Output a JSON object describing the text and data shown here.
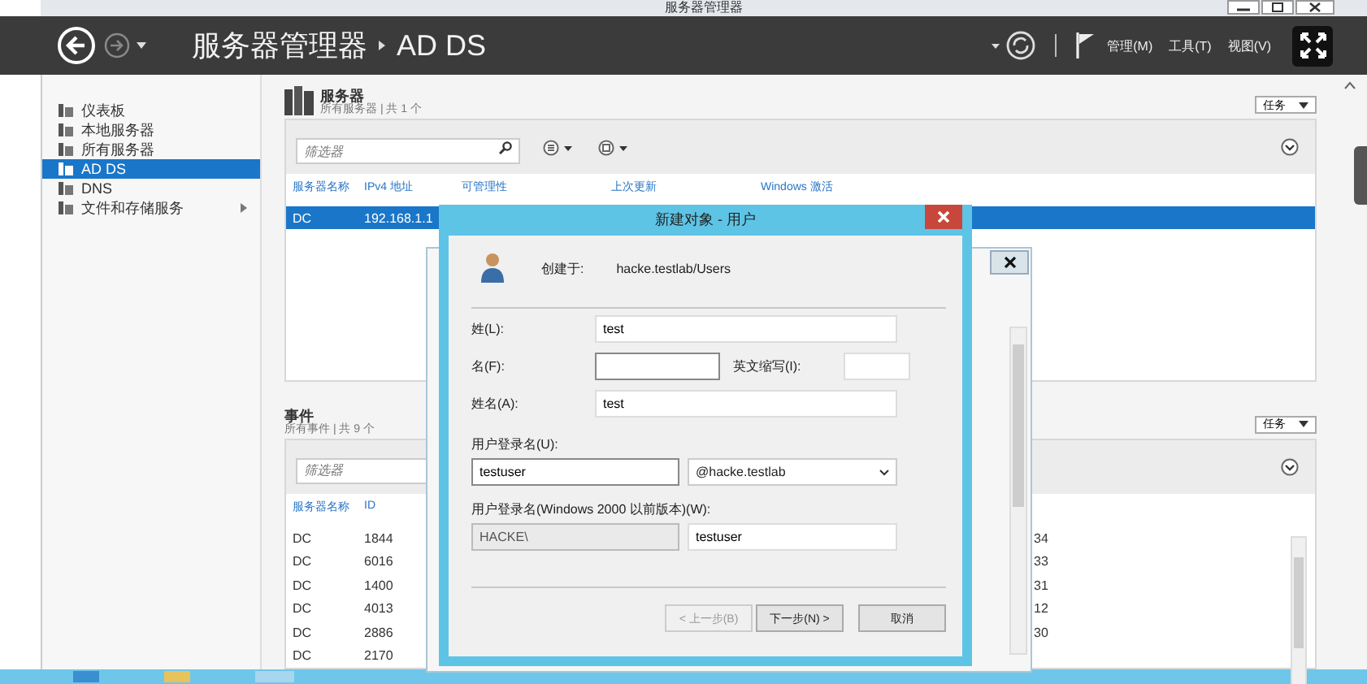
{
  "window": {
    "title": "服务器管理器"
  },
  "header": {
    "breadcrumb": [
      "服务器管理器",
      "AD DS"
    ],
    "menus": [
      "管理(M)",
      "工具(T)",
      "视图(V)"
    ]
  },
  "sidebar": {
    "items": [
      {
        "label": "仪表板",
        "selected": false,
        "has_submenu": false
      },
      {
        "label": "本地服务器",
        "selected": false,
        "has_submenu": false
      },
      {
        "label": "所有服务器",
        "selected": false,
        "has_submenu": false
      },
      {
        "label": "AD DS",
        "selected": true,
        "has_submenu": false
      },
      {
        "label": "DNS",
        "selected": false,
        "has_submenu": false
      },
      {
        "label": "文件和存储服务",
        "selected": false,
        "has_submenu": true
      }
    ]
  },
  "servers": {
    "title": "服务器",
    "subtitle": "所有服务器 | 共 1 个",
    "tasks_button": "任务",
    "filter": {
      "placeholder": "筛选器"
    },
    "columns": [
      "服务器名称",
      "IPv4 地址",
      "可管理性",
      "上次更新",
      "Windows 激活"
    ],
    "rows": [
      {
        "cells": [
          "DC",
          "192.168.1.1"
        ],
        "selected": true
      }
    ]
  },
  "events": {
    "title": "事件",
    "subtitle": "所有事件 | 共 9 个",
    "tasks_button": "任务",
    "filter": {
      "placeholder": "筛选器"
    },
    "columns": [
      "服务器名称",
      "ID"
    ],
    "rows": [
      {
        "cells": [
          "DC",
          "1844"
        ],
        "end": "34"
      },
      {
        "cells": [
          "DC",
          "6016"
        ],
        "end": "33"
      },
      {
        "cells": [
          "DC",
          "1400"
        ],
        "end": "31"
      },
      {
        "cells": [
          "DC",
          "4013"
        ],
        "end": "12"
      },
      {
        "cells": [
          "DC",
          "2886"
        ],
        "end": "30"
      },
      {
        "cells": [
          "DC",
          "2170"
        ]
      }
    ]
  },
  "dialog": {
    "title": "新建对象 - 用户",
    "created_in_label": "创建于:",
    "created_in": "hacke.testlab/Users",
    "last_name": {
      "label": "姓(L):",
      "value": "test"
    },
    "first_name": {
      "label": "名(F):"
    },
    "initials": {
      "label": "英文缩写(I):"
    },
    "full_name": {
      "label": "姓名(A):",
      "value": "test"
    },
    "logon": {
      "label": "用户登录名(U):",
      "value": "testuser",
      "domain": "@hacke.testlab"
    },
    "logon_pre2000": {
      "label": "用户登录名(Windows 2000 以前版本)(W):",
      "domain": "HACKE\\",
      "value": "testuser"
    },
    "buttons": [
      {
        "label": "< 上一步(B)",
        "disabled": true
      },
      {
        "label": "下一步(N) >",
        "disabled": false
      },
      {
        "label": "取消",
        "disabled": false
      }
    ]
  }
}
